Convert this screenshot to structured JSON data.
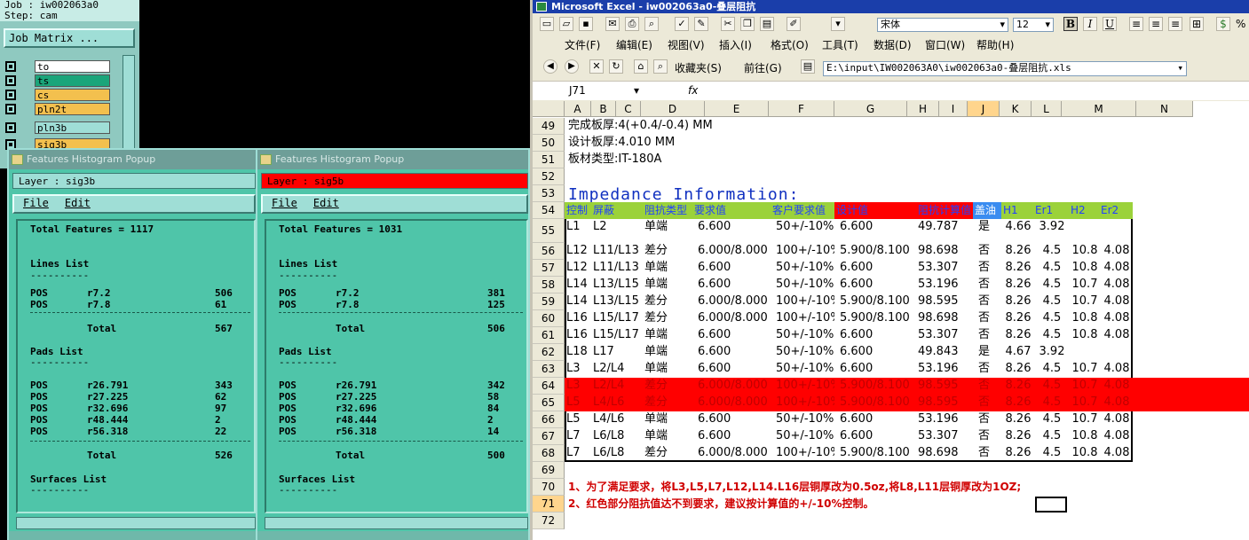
{
  "left_panel": {
    "job": "Job : iw002063a0",
    "step": "Step: cam",
    "job_matrix_button": "Job Matrix ...",
    "layers": [
      {
        "name": "to",
        "color": "#ffffff"
      },
      {
        "name": "ts",
        "color": "#1aa57a"
      },
      {
        "name": "cs",
        "color": "#f3c04e"
      },
      {
        "name": "pln2t",
        "color": "#f3c04e"
      },
      {
        "name": "pln3b",
        "color": "#9fded6"
      },
      {
        "name": "sig3b",
        "color": "#f3c04e"
      }
    ]
  },
  "popups": [
    {
      "title": "Features Histogram Popup",
      "layer_label": "Layer :  sig3b",
      "layer_bg": "#9fded6",
      "menu": [
        "File",
        "Edit"
      ],
      "total": "Total Features = 1117",
      "lines_title": "Lines List",
      "lines": [
        {
          "pos": "POS",
          "sym": "r7.2",
          "count": "506"
        },
        {
          "pos": "POS",
          "sym": "r7.8",
          "count": "61"
        }
      ],
      "lines_total_label": "Total",
      "lines_total": "567",
      "pads_title": "Pads List",
      "pads": [
        {
          "pos": "POS",
          "sym": "r26.791",
          "count": "343"
        },
        {
          "pos": "POS",
          "sym": "r27.225",
          "count": "62"
        },
        {
          "pos": "POS",
          "sym": "r32.696",
          "count": "97"
        },
        {
          "pos": "POS",
          "sym": "r48.444",
          "count": "2"
        },
        {
          "pos": "POS",
          "sym": "r56.318",
          "count": "22"
        }
      ],
      "pads_total_label": "Total",
      "pads_total": "526",
      "surfaces_title": "Surfaces List"
    },
    {
      "title": "Features Histogram Popup",
      "layer_label": "Layer :  sig5b",
      "layer_bg": "#ff0000",
      "menu": [
        "File",
        "Edit"
      ],
      "total": "Total Features = 1031",
      "lines_title": "Lines List",
      "lines": [
        {
          "pos": "POS",
          "sym": "r7.2",
          "count": "381"
        },
        {
          "pos": "POS",
          "sym": "r7.8",
          "count": "125"
        }
      ],
      "lines_total_label": "Total",
      "lines_total": "506",
      "pads_title": "Pads List",
      "pads": [
        {
          "pos": "POS",
          "sym": "r26.791",
          "count": "342"
        },
        {
          "pos": "POS",
          "sym": "r27.225",
          "count": "58"
        },
        {
          "pos": "POS",
          "sym": "r32.696",
          "count": "84"
        },
        {
          "pos": "POS",
          "sym": "r48.444",
          "count": "2"
        },
        {
          "pos": "POS",
          "sym": "r56.318",
          "count": "14"
        }
      ],
      "pads_total_label": "Total",
      "pads_total": "500",
      "surfaces_title": "Surfaces List"
    }
  ],
  "excel": {
    "title": "Microsoft Excel - iw002063a0-叠层阻抗",
    "menus": [
      "文件(F)",
      "编辑(E)",
      "视图(V)",
      "插入(I)",
      "格式(O)",
      "工具(T)",
      "数据(D)",
      "窗口(W)",
      "帮助(H)"
    ],
    "font_name": "宋体",
    "font_size": "12",
    "favorites": "收藏夹(S)",
    "goto": "前往(G)",
    "path": "E:\\input\\IW002063A0\\iw002063a0-叠层阻抗.xls",
    "name_box": "J71",
    "fx": "fx",
    "columns": [
      "A",
      "B",
      "C",
      "D",
      "E",
      "F",
      "G",
      "H",
      "I",
      "J",
      "K",
      "L",
      "M",
      "N"
    ],
    "selected_column": "J",
    "selected_row": "71",
    "rows": [
      "49",
      "50",
      "51",
      "52",
      "53",
      "54",
      "55",
      "56",
      "57",
      "58",
      "59",
      "60",
      "61",
      "62",
      "63",
      "64",
      "65",
      "66",
      "67",
      "68",
      "69",
      "70",
      "71",
      "72"
    ],
    "info": {
      "r49": "完成板厚:4(+0.4/-0.4) MM",
      "r50": "设计板厚:4.010 MM",
      "r51": "板材类型:IT-180A",
      "r53": "Impedance Information:"
    },
    "table_header": [
      "控制",
      "屏蔽",
      "阻抗类型",
      "要求值",
      "客户要求值",
      "设计值",
      "阻抗计算值",
      "盖油",
      "H1",
      "Er1",
      "H2",
      "Er2"
    ],
    "table_rows": [
      {
        "row": "55",
        "hl": false,
        "cells": [
          "L1",
          "L2",
          "单端",
          "6.600",
          "50+/-10%",
          "6.600",
          "49.787",
          "是",
          "4.66",
          "3.92",
          "",
          ""
        ]
      },
      {
        "row": "56",
        "hl": false,
        "cells": [
          "L12",
          "L11/L13",
          "差分",
          "6.000/8.000",
          "100+/-10%",
          "5.900/8.100",
          "98.698",
          "否",
          "8.26",
          "4.5",
          "10.8",
          "4.08"
        ]
      },
      {
        "row": "57",
        "hl": false,
        "cells": [
          "L12",
          "L11/L13",
          "单端",
          "6.600",
          "50+/-10%",
          "6.600",
          "53.307",
          "否",
          "8.26",
          "4.5",
          "10.8",
          "4.08"
        ]
      },
      {
        "row": "58",
        "hl": false,
        "cells": [
          "L14",
          "L13/L15",
          "单端",
          "6.600",
          "50+/-10%",
          "6.600",
          "53.196",
          "否",
          "8.26",
          "4.5",
          "10.7",
          "4.08"
        ]
      },
      {
        "row": "59",
        "hl": false,
        "cells": [
          "L14",
          "L13/L15",
          "差分",
          "6.000/8.000",
          "100+/-10%",
          "5.900/8.100",
          "98.595",
          "否",
          "8.26",
          "4.5",
          "10.7",
          "4.08"
        ]
      },
      {
        "row": "60",
        "hl": false,
        "cells": [
          "L16",
          "L15/L17",
          "差分",
          "6.000/8.000",
          "100+/-10%",
          "5.900/8.100",
          "98.698",
          "否",
          "8.26",
          "4.5",
          "10.8",
          "4.08"
        ]
      },
      {
        "row": "61",
        "hl": false,
        "cells": [
          "L16",
          "L15/L17",
          "单端",
          "6.600",
          "50+/-10%",
          "6.600",
          "53.307",
          "否",
          "8.26",
          "4.5",
          "10.8",
          "4.08"
        ]
      },
      {
        "row": "62",
        "hl": false,
        "cells": [
          "L18",
          "L17",
          "单端",
          "6.600",
          "50+/-10%",
          "6.600",
          "49.843",
          "是",
          "4.67",
          "3.92",
          "",
          ""
        ]
      },
      {
        "row": "63",
        "hl": false,
        "cells": [
          "L3",
          "L2/L4",
          "单端",
          "6.600",
          "50+/-10%",
          "6.600",
          "53.196",
          "否",
          "8.26",
          "4.5",
          "10.7",
          "4.08"
        ]
      },
      {
        "row": "64",
        "hl": true,
        "cells": [
          "L3",
          "L2/L4",
          "差分",
          "6.000/8.000",
          "100+/-10%",
          "5.900/8.100",
          "98.595",
          "否",
          "8.26",
          "4.5",
          "10.7",
          "4.08"
        ]
      },
      {
        "row": "65",
        "hl": true,
        "cells": [
          "L5",
          "L4/L6",
          "差分",
          "6.000/8.000",
          "100+/-10%",
          "5.900/8.100",
          "98.595",
          "否",
          "8.26",
          "4.5",
          "10.7",
          "4.08"
        ]
      },
      {
        "row": "66",
        "hl": false,
        "cells": [
          "L5",
          "L4/L6",
          "单端",
          "6.600",
          "50+/-10%",
          "6.600",
          "53.196",
          "否",
          "8.26",
          "4.5",
          "10.7",
          "4.08"
        ]
      },
      {
        "row": "67",
        "hl": false,
        "cells": [
          "L7",
          "L6/L8",
          "单端",
          "6.600",
          "50+/-10%",
          "6.600",
          "53.307",
          "否",
          "8.26",
          "4.5",
          "10.8",
          "4.08"
        ]
      },
      {
        "row": "68",
        "hl": false,
        "cells": [
          "L7",
          "L6/L8",
          "差分",
          "6.000/8.000",
          "100+/-10%",
          "5.900/8.100",
          "98.698",
          "否",
          "8.26",
          "4.5",
          "10.8",
          "4.08"
        ]
      }
    ],
    "note1": "1、为了满足要求，将L3,L5,L7,L12,L14.L16层铜厚改为0.5oz,将L8,L11层铜厚改为1OZ;",
    "note2": "2、红色部分阻抗值达不到要求，建议按计算值的+/-10%控制。"
  }
}
